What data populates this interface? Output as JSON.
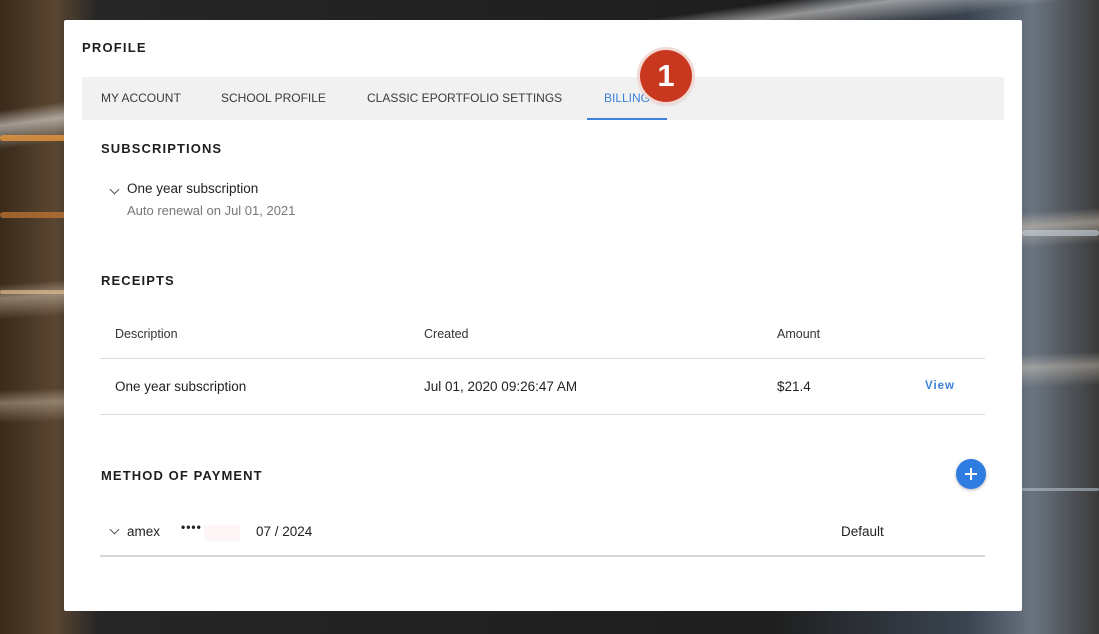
{
  "page": {
    "title": "PROFILE"
  },
  "tabs": [
    {
      "label": "MY ACCOUNT",
      "active": false
    },
    {
      "label": "SCHOOL PROFILE",
      "active": false
    },
    {
      "label": "CLASSIC EPORTFOLIO SETTINGS",
      "active": false
    },
    {
      "label": "BILLING",
      "active": true
    }
  ],
  "annotation": {
    "step_number": "1",
    "color": "#c8381f"
  },
  "subscriptions": {
    "title": "SUBSCRIPTIONS",
    "item": {
      "name": "One year subscription",
      "renewal": "Auto renewal on Jul 01, 2021"
    }
  },
  "receipts": {
    "title": "RECEIPTS",
    "columns": [
      "Description",
      "Created",
      "Amount"
    ],
    "rows": [
      {
        "description": "One year subscription",
        "created": "Jul 01, 2020 09:26:47 AM",
        "amount": "$21.4",
        "action": "View"
      }
    ]
  },
  "payment": {
    "title": "METHOD OF PAYMENT",
    "add_icon": "plus-icon",
    "method": {
      "brand": "amex",
      "masked": "••••",
      "expiry": "07 / 2024",
      "status": "Default"
    }
  },
  "colors": {
    "accent": "#3b82d9",
    "add_button": "#2f7de1",
    "tabbar_bg": "#f2f1f1"
  }
}
